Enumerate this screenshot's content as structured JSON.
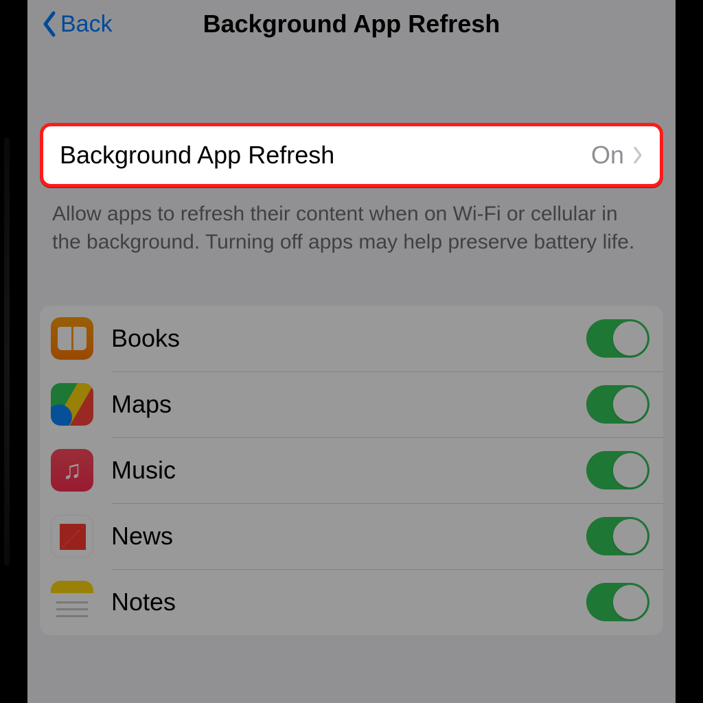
{
  "nav": {
    "back_label": "Back",
    "title": "Background App Refresh"
  },
  "master": {
    "label": "Background App Refresh",
    "value": "On"
  },
  "footer": "Allow apps to refresh their content when on Wi-Fi or cellular in the background. Turning off apps may help preserve battery life.",
  "apps": [
    {
      "name": "Books",
      "on": true
    },
    {
      "name": "Maps",
      "on": true
    },
    {
      "name": "Music",
      "on": true
    },
    {
      "name": "News",
      "on": true
    },
    {
      "name": "Notes",
      "on": true
    }
  ]
}
